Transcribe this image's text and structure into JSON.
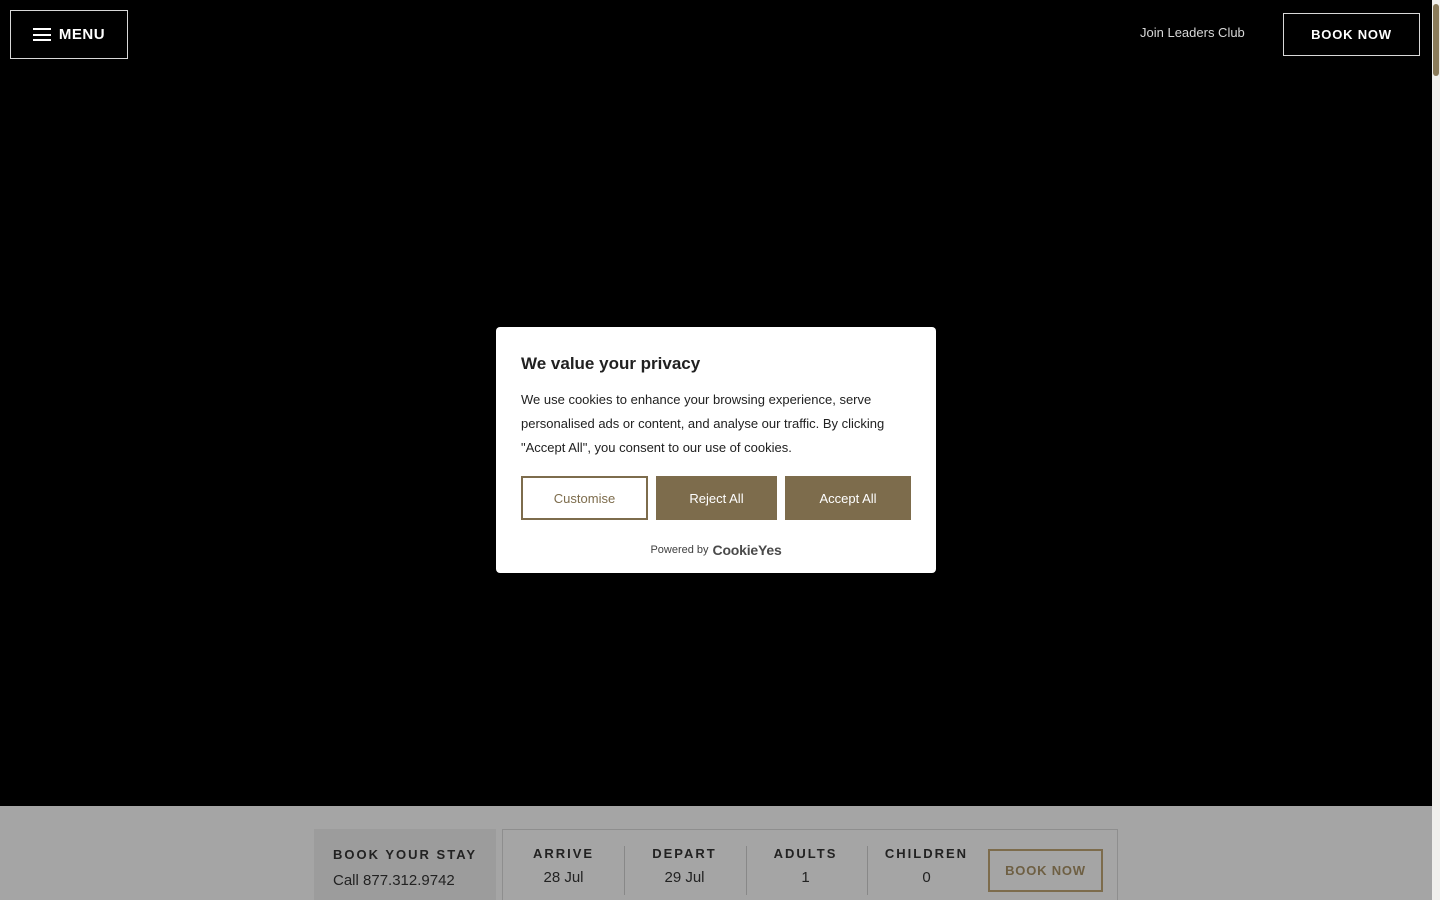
{
  "header": {
    "menu_label": "MENU",
    "join_label": "Join Leaders Club",
    "book_label": "BOOK NOW"
  },
  "cookie_modal": {
    "title": "We value your privacy",
    "text": "We use cookies to enhance your browsing experience, serve personalised ads or content, and analyse our traffic. By clicking \"Accept All\", you consent to our use of cookies.",
    "customise_label": "Customise",
    "reject_label": "Reject All",
    "accept_label": "Accept All",
    "powered_by": "Powered by",
    "brand": "CookieYes"
  },
  "booking_bar": {
    "title": "BOOK YOUR STAY",
    "phone": "Call 877.312.9742",
    "fields": [
      {
        "label": "ARRIVE",
        "value": "28 Jul"
      },
      {
        "label": "DEPART",
        "value": "29 Jul"
      },
      {
        "label": "ADULTS",
        "value": "1"
      },
      {
        "label": "CHILDREN",
        "value": "0"
      }
    ],
    "book_label": "BOOK NOW"
  },
  "colors": {
    "accent": "#7d6c4c",
    "background": "#000000",
    "bar": "#a5a5a5"
  }
}
